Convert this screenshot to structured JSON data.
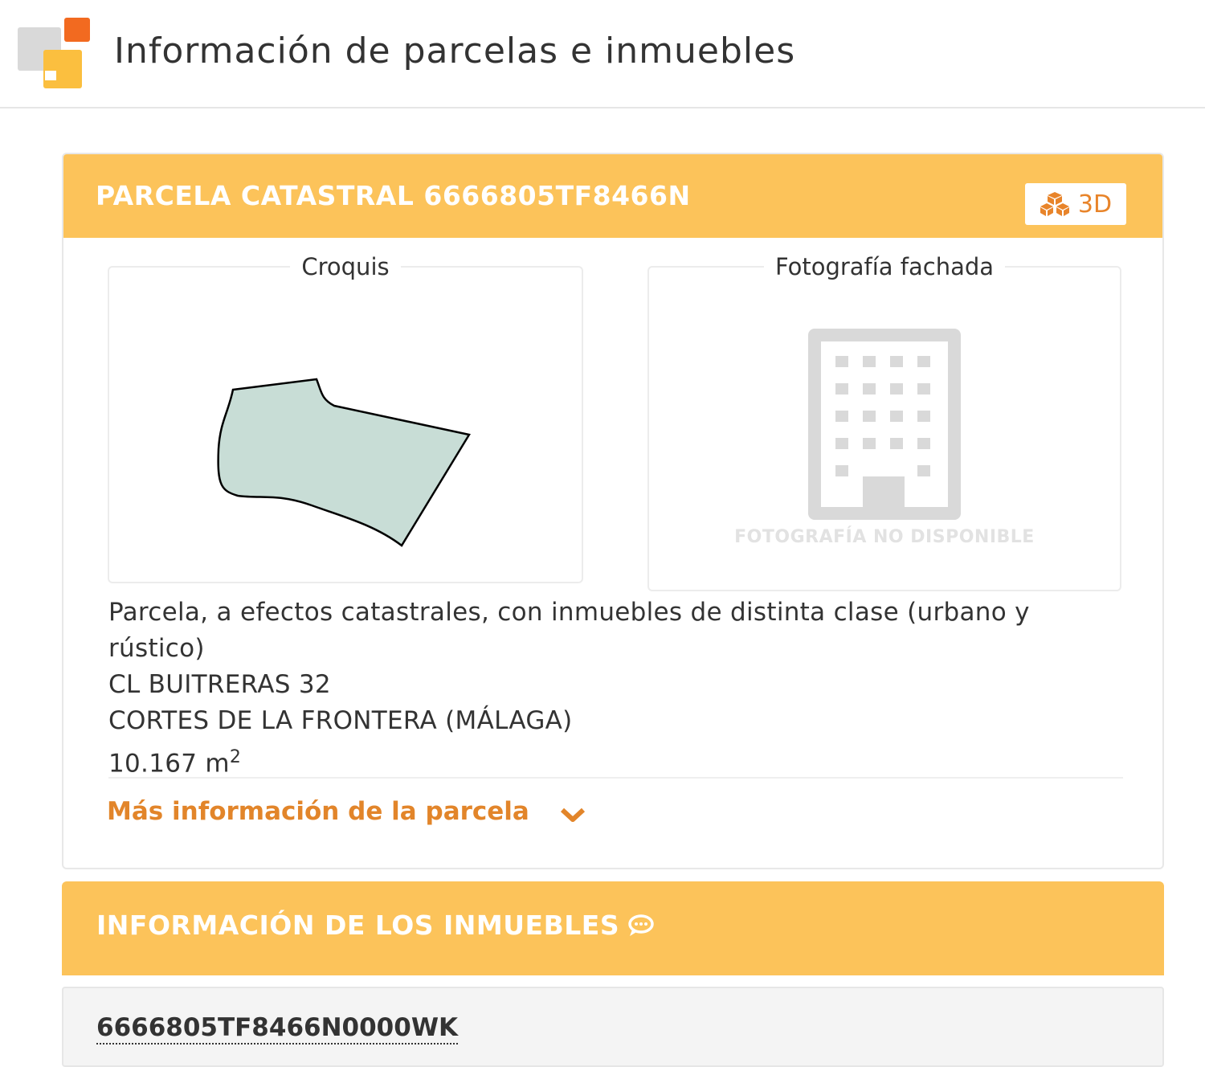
{
  "header": {
    "title": "Información de parcelas e inmuebles"
  },
  "parcel": {
    "title": "PARCELA CATASTRAL 6666805TF8466N",
    "btn_3d_label": "3D",
    "sketch_legend": "Croquis",
    "photo_legend": "Fotografía fachada",
    "photo_unavailable": "FOTOGRAFÍA NO DISPONIBLE",
    "description": "Parcela, a efectos catastrales, con inmuebles de distinta clase (urbano y rústico)",
    "address": "CL BUITRERAS 32",
    "locality": "CORTES DE LA FRONTERA (MÁLAGA)",
    "area_value": "10.167 m",
    "area_sup": "2",
    "more_info_link": "Más información de la parcela"
  },
  "properties": {
    "title": "INFORMACIÓN DE LOS INMUEBLES",
    "first_reference": "6666805TF8466N0000WK"
  },
  "colors": {
    "header_bar": "#fcc35a",
    "accent_orange": "#e2852a",
    "parcel_fill": "#c8ddd6",
    "logo_orange": "#f26a20",
    "logo_yellow": "#fbbf3f"
  },
  "icons": {
    "btn_3d": "cubes-icon",
    "more_info": "chevron-down-icon",
    "properties": "comment-icon",
    "photo_placeholder": "building-icon"
  }
}
